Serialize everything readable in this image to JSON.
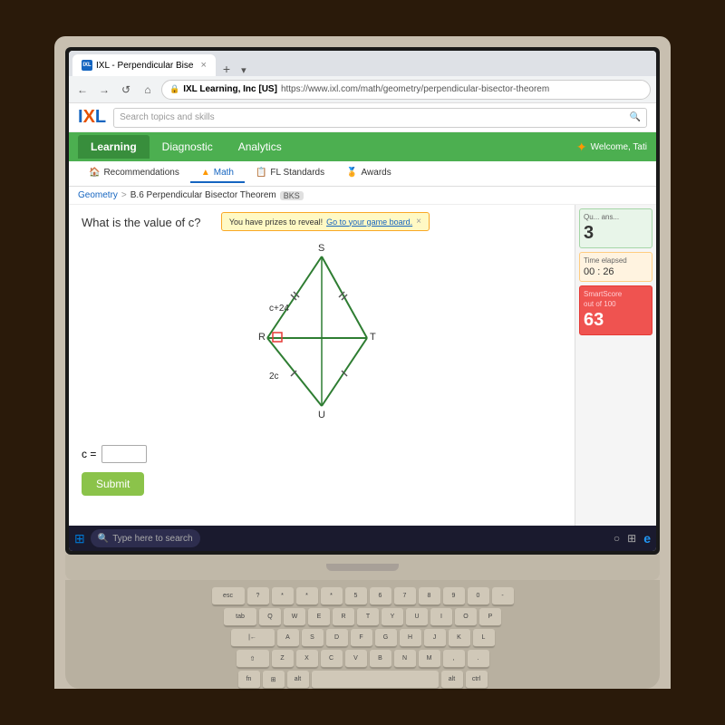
{
  "browser": {
    "tab_label": "IXL - Perpendicular Bise",
    "favicon_text": "IXL",
    "address": "IXL Learning, Inc [US]",
    "url": "https://www.ixl.com/math/geometry/perpendicular-bisector-theorem",
    "back_btn": "←",
    "forward_btn": "→",
    "refresh_btn": "↺",
    "home_btn": "⌂",
    "plus_btn": "+"
  },
  "ixl": {
    "logo_i": "I",
    "logo_x": "X",
    "logo_l": "L",
    "search_placeholder": "Search topics and skills",
    "welcome": "Welcome, Tati"
  },
  "nav": {
    "tabs": [
      "Learning",
      "Diagnostic",
      "Analytics"
    ],
    "active_tab": "Learning"
  },
  "sub_tabs": {
    "items": [
      "Recommendations",
      "Math",
      "FL Standards",
      "Awards"
    ],
    "active": "Math",
    "recommendations_icon": "🏠",
    "math_icon": "▲",
    "fl_icon": "📋"
  },
  "breadcrumb": {
    "geometry": "Geometry",
    "separator": ">",
    "current": "B.6 Perpendicular Bisector Theorem",
    "tag": "BKS"
  },
  "prize_notification": {
    "text": "You have prizes to reveal!",
    "link": "Go to your game board.",
    "close": "×"
  },
  "problem": {
    "question": "What is the value of c?",
    "labels": {
      "s": "S",
      "r": "R",
      "t": "T",
      "u": "U",
      "c_plus_24": "c+24",
      "two_c": "2c"
    },
    "answer_label": "c =",
    "answer_placeholder": "",
    "submit_label": "Submit"
  },
  "sidebar": {
    "question_label": "Qu...",
    "answer_label": "ans...",
    "score": "3",
    "time_label": "Ti...",
    "elapsed_label": "elap...",
    "time_minutes": "00",
    "time_seconds": "26",
    "smartscore_label": "SmartSc...",
    "smartscore_sub": "out of 100",
    "smartscore_value": "63"
  },
  "taskbar": {
    "search_placeholder": "Type here to search",
    "windows_icon": "⊞"
  },
  "colors": {
    "ixl_blue": "#1565c0",
    "ixl_orange": "#e65100",
    "nav_green": "#4caf50",
    "submit_green": "#8bc34a",
    "smartscore_red": "#ef5350"
  }
}
